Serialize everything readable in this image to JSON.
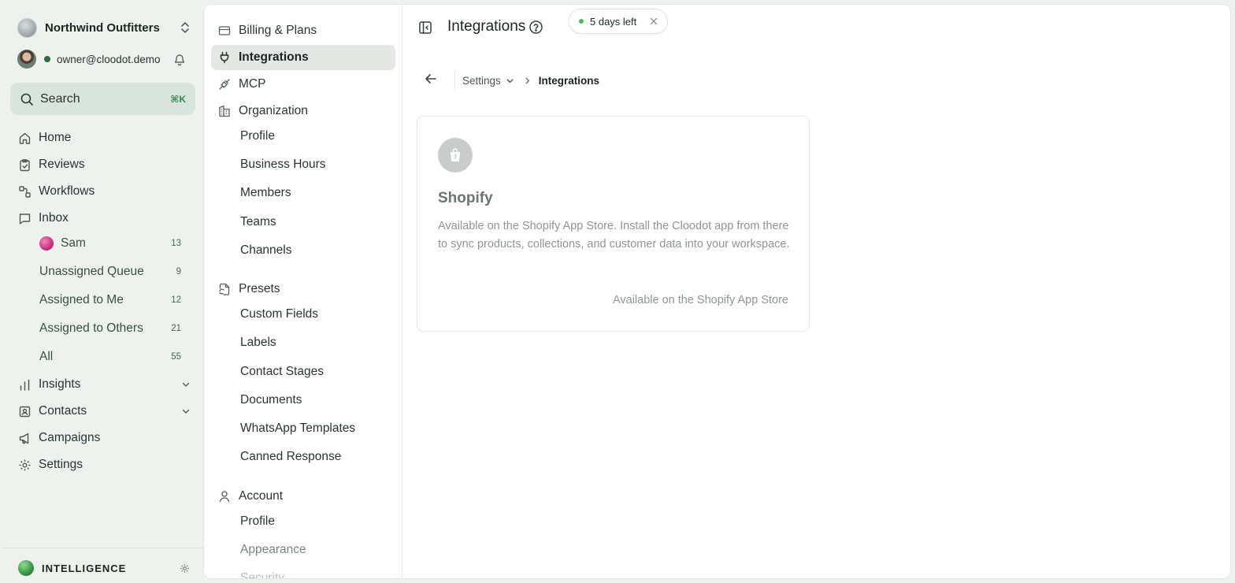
{
  "org": {
    "name": "Northwind Outfitters"
  },
  "user": {
    "email": "owner@cloodot.demo"
  },
  "search": {
    "label": "Search",
    "shortcut": "⌘K"
  },
  "nav": {
    "home": "Home",
    "reviews": "Reviews",
    "workflows": "Workflows",
    "inbox": "Inbox",
    "inbox_items": [
      {
        "label": "Sam",
        "count": "13"
      },
      {
        "label": "Unassigned Queue",
        "count": "9"
      },
      {
        "label": "Assigned to Me",
        "count": "12"
      },
      {
        "label": "Assigned to Others",
        "count": "21"
      },
      {
        "label": "All",
        "count": "55"
      }
    ],
    "insights": "Insights",
    "contacts": "Contacts",
    "campaigns": "Campaigns",
    "settings": "Settings"
  },
  "intelligence": {
    "label": "INTELLIGENCE"
  },
  "settings_nav": {
    "billing": "Billing & Plans",
    "integrations": "Integrations",
    "mcp": "MCP",
    "organization": "Organization",
    "organization_items": [
      "Profile",
      "Business Hours",
      "Members",
      "Teams",
      "Channels"
    ],
    "presets": "Presets",
    "presets_items": [
      "Custom Fields",
      "Labels",
      "Contact Stages",
      "Documents",
      "WhatsApp Templates",
      "Canned Response"
    ],
    "account": "Account",
    "account_items": [
      "Profile",
      "Appearance",
      "Security"
    ]
  },
  "page": {
    "title": "Integrations",
    "trial_label": "5 days left",
    "breadcrumb": {
      "parent": "Settings",
      "current": "Integrations"
    }
  },
  "integration_card": {
    "name": "Shopify",
    "description": "Available on the Shopify App Store. Install the Cloodot app from there to sync products, collections, and customer data into your workspace.",
    "footer": "Available on the Shopify App Store"
  },
  "colors": {
    "accent": "#3a8a54",
    "online": "#2f6b3c",
    "trial_dot": "#4fb85f",
    "sidebar_bg": "#eef2ef",
    "active_item": "#e3e8e5"
  }
}
